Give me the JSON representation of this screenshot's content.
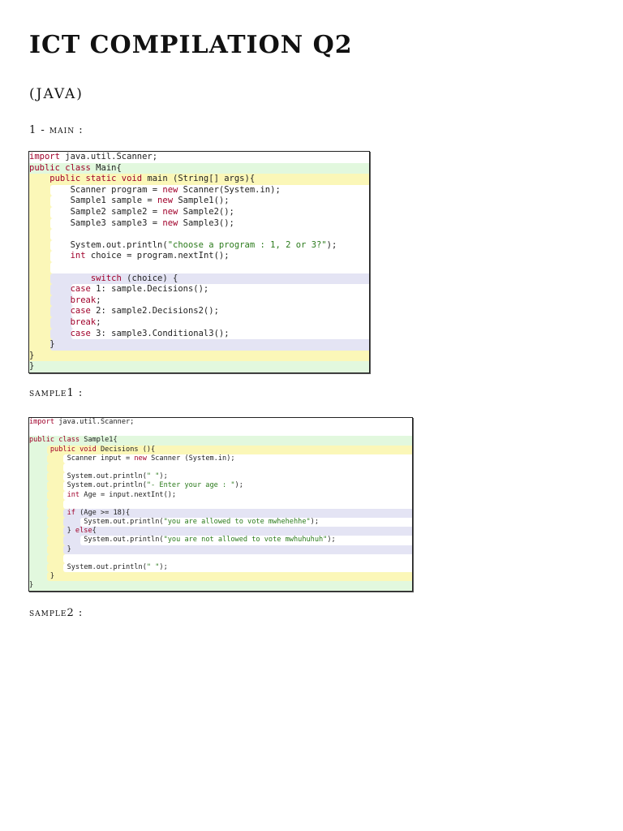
{
  "document": {
    "title": "ICT COMPILATION Q2",
    "subtitle": "(JAVA)",
    "sections": [
      {
        "label": "1 - main :"
      },
      {
        "label": "sample1 :"
      },
      {
        "label": "sample2 :"
      }
    ]
  },
  "snippets": [
    {
      "lines": [
        [
          [
            "import",
            "kw"
          ],
          [
            " java.util.Scanner;",
            "pl"
          ]
        ],
        [
          [
            "public class",
            "kw"
          ],
          [
            " Main{",
            "pl"
          ]
        ],
        [
          [
            "    public static void",
            "kw"
          ],
          [
            " main (String[] args){",
            "pl"
          ]
        ],
        [
          [
            "        Scanner program = ",
            "pl"
          ],
          [
            "new",
            "kw"
          ],
          [
            " Scanner(System.in);",
            "pl"
          ]
        ],
        [
          [
            "        Sample1 sample = ",
            "pl"
          ],
          [
            "new",
            "kw"
          ],
          [
            " Sample1();",
            "pl"
          ]
        ],
        [
          [
            "        Sample2 sample2 = ",
            "pl"
          ],
          [
            "new",
            "kw"
          ],
          [
            " Sample2();",
            "pl"
          ]
        ],
        [
          [
            "        Sample3 sample3 = ",
            "pl"
          ],
          [
            "new",
            "kw"
          ],
          [
            " Sample3();",
            "pl"
          ]
        ],
        [],
        [
          [
            "        System.out.println(",
            "pl"
          ],
          [
            "\"choose a program : 1, 2 or 3?\"",
            "str"
          ],
          [
            ");",
            "pl"
          ]
        ],
        [
          [
            "        int",
            "kw"
          ],
          [
            " choice = program.nextInt();",
            "pl"
          ]
        ],
        [],
        [
          [
            "            switch",
            "kw"
          ],
          [
            " (choice) {",
            "pl"
          ]
        ],
        [
          [
            "        case",
            "kw"
          ],
          [
            " 1: sample.Decisions();",
            "pl"
          ]
        ],
        [
          [
            "        break",
            "kw"
          ],
          [
            ";",
            "pl"
          ]
        ],
        [
          [
            "        case",
            "kw"
          ],
          [
            " 2: sample2.Decisions2();",
            "pl"
          ]
        ],
        [
          [
            "        break",
            "kw"
          ],
          [
            ";",
            "pl"
          ]
        ],
        [
          [
            "        case",
            "kw"
          ],
          [
            " 3: sample3.Conditional3();",
            "pl"
          ]
        ],
        [
          [
            "    }",
            "pl"
          ]
        ],
        [
          [
            "}",
            "pl"
          ]
        ],
        [
          [
            "}",
            "pl"
          ]
        ]
      ]
    },
    {
      "lines": [
        [
          [
            "import",
            "kw"
          ],
          [
            " java.util.Scanner;",
            "pl"
          ]
        ],
        [],
        [
          [
            "public class",
            "kw"
          ],
          [
            " Sample1{",
            "pl"
          ]
        ],
        [
          [
            "     public void",
            "kw"
          ],
          [
            " Decisions (){",
            "pl"
          ]
        ],
        [
          [
            "         Scanner input = ",
            "pl"
          ],
          [
            "new",
            "kw"
          ],
          [
            " Scanner (System.in);",
            "pl"
          ]
        ],
        [],
        [
          [
            "         System.out.println(",
            "pl"
          ],
          [
            "\" \"",
            "str"
          ],
          [
            ");",
            "pl"
          ]
        ],
        [
          [
            "         System.out.println(",
            "pl"
          ],
          [
            "\"- Enter your age : \"",
            "str"
          ],
          [
            ");",
            "pl"
          ]
        ],
        [
          [
            "         int",
            "kw"
          ],
          [
            " Age = input.nextInt();",
            "pl"
          ]
        ],
        [],
        [
          [
            "         if",
            "kw"
          ],
          [
            " (Age >= 18){",
            "pl"
          ]
        ],
        [
          [
            "             System.out.println(",
            "pl"
          ],
          [
            "\"you are allowed to vote mwhehehhe\"",
            "str"
          ],
          [
            ");",
            "pl"
          ]
        ],
        [
          [
            "         } ",
            "pl"
          ],
          [
            "else",
            "kw"
          ],
          [
            "{",
            "pl"
          ]
        ],
        [
          [
            "             System.out.println(",
            "pl"
          ],
          [
            "\"you are not allowed to vote mwhuhuhuh\"",
            "str"
          ],
          [
            ");",
            "pl"
          ]
        ],
        [
          [
            "         }",
            "pl"
          ]
        ],
        [],
        [
          [
            "         System.out.println(",
            "pl"
          ],
          [
            "\" \"",
            "str"
          ],
          [
            ");",
            "pl"
          ]
        ],
        [
          [
            "     }",
            "pl"
          ]
        ],
        [
          [
            "}",
            "pl"
          ]
        ]
      ]
    }
  ],
  "colors": {
    "green": "#e2f8de",
    "yellow": "#fbf7b8",
    "lavender": "#e4e4f4",
    "white": "#ffffff",
    "keyword": "#a0002a",
    "string": "#2a7a1a"
  }
}
